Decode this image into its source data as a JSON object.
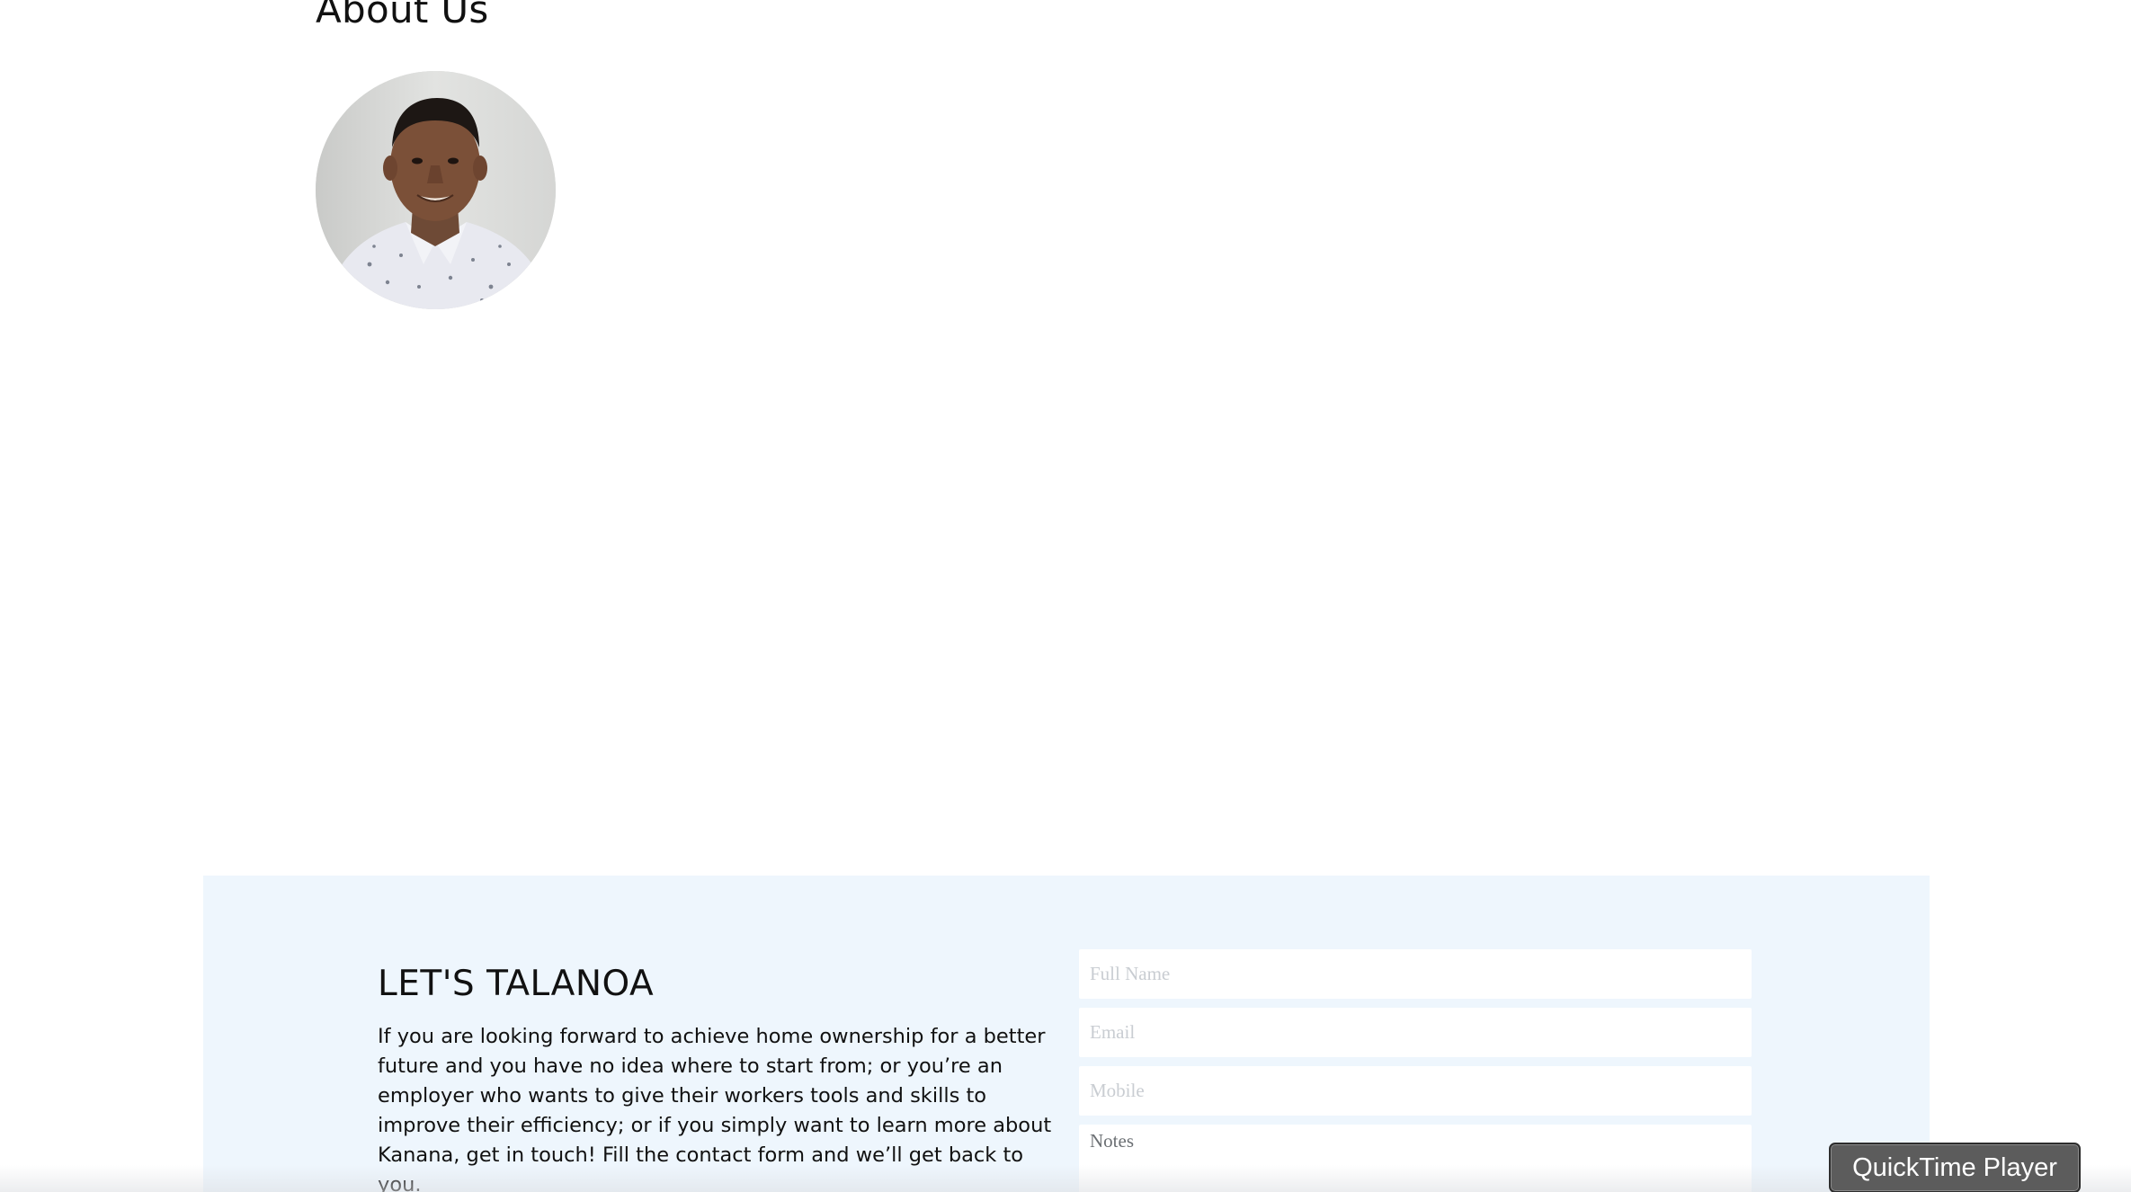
{
  "about": {
    "title": "About Us"
  },
  "contact": {
    "title": "LET'S TALANOA",
    "description": "If you are looking forward to achieve home ownership for a better future and you have no idea where to start from; or you’re an employer who wants to give their workers tools and skills to improve their efficiency; or if you simply want to learn more about Kanana, get in touch! Fill the contact form and we’ll get back to you.",
    "form": {
      "full_name_placeholder": "Full Name",
      "email_placeholder": "Email",
      "mobile_placeholder": "Mobile",
      "notes_placeholder": "Notes"
    }
  },
  "tooltip": {
    "label": "QuickTime Player"
  },
  "colors": {
    "section_background": "#eef6fd",
    "tooltip_background": "#5c5c5c"
  }
}
